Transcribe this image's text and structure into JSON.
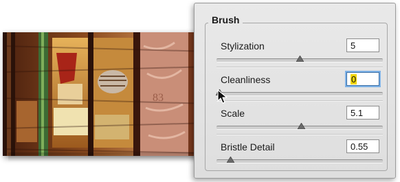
{
  "panel": {
    "title": "Brush",
    "params": [
      {
        "label": "Stylization",
        "value": "5",
        "fraction": 0.5,
        "focused": false
      },
      {
        "label": "Cleanliness",
        "value": "0",
        "fraction": 0.0,
        "focused": true
      },
      {
        "label": "Scale",
        "value": "5.1",
        "fraction": 0.51,
        "focused": false
      },
      {
        "label": "Bristle Detail",
        "value": "0.55",
        "fraction": 0.07,
        "focused": false
      }
    ]
  },
  "icons": {
    "cursor": "arrow-pointer-icon",
    "thumb": "slider-triangle-icon"
  },
  "colors": {
    "panel_bg": "#e6e6e6",
    "focus_ring": "#7fb2e6",
    "selection_highlight": "#f2d600",
    "photo_dark": "#3b1a0e",
    "photo_amber": "#b9772e"
  }
}
